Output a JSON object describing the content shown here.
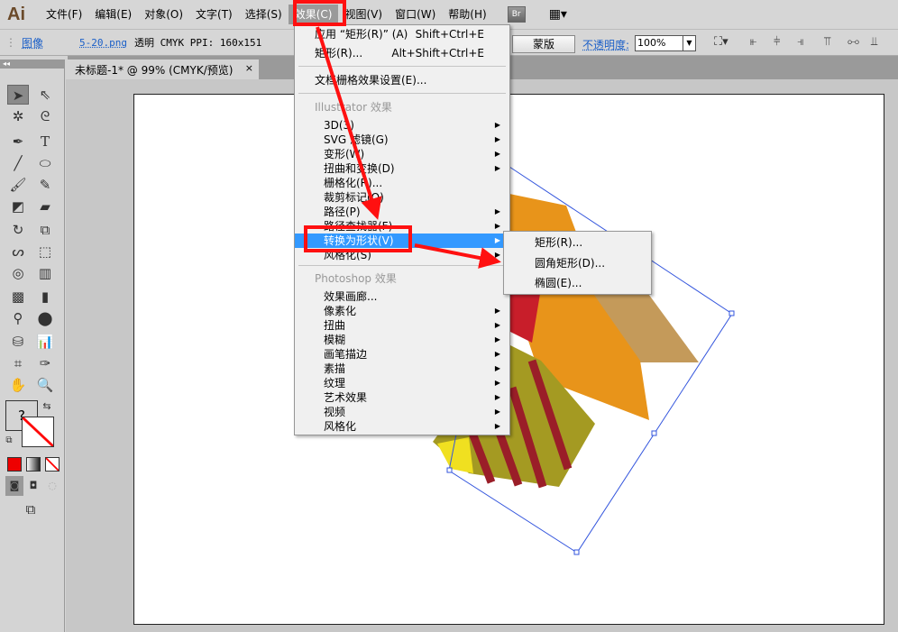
{
  "app": {
    "logo": "Ai"
  },
  "menubar": {
    "items": [
      "文件(F)",
      "编辑(E)",
      "对象(O)",
      "文字(T)",
      "选择(S)",
      "效果(C)",
      "视图(V)",
      "窗口(W)",
      "帮助(H)"
    ],
    "bridge": "Br"
  },
  "control": {
    "type": "图像",
    "file": "5-20.png",
    "info": "透明 CMYK  PPI: 160x151",
    "mask": "蒙版",
    "opacity_label": "不透明度:",
    "opacity": "100%"
  },
  "document": {
    "tab": "未标题-1* @ 99% (CMYK/预览)",
    "close": "×"
  },
  "tools": {
    "question": "?"
  },
  "effect_menu": {
    "apply": {
      "label": "应用 “矩形(R)” (A)",
      "shortcut": "Shift+Ctrl+E"
    },
    "rect": {
      "label": "矩形(R)...",
      "shortcut": "Alt+Shift+Ctrl+E"
    },
    "raster_settings": "文档栅格效果设置(E)...",
    "illustrator_header": "Illustrator 效果",
    "illustrator_items": [
      {
        "label": "3D(3)",
        "sub": true
      },
      {
        "label": "SVG 滤镜(G)",
        "sub": true
      },
      {
        "label": "变形(W)",
        "sub": true
      },
      {
        "label": "扭曲和变换(D)",
        "sub": true
      },
      {
        "label": "栅格化(R)...",
        "sub": false
      },
      {
        "label": "裁剪标记(O)",
        "sub": false
      },
      {
        "label": "路径(P)",
        "sub": true
      },
      {
        "label": "路径查找器(F)",
        "sub": true
      },
      {
        "label": "转换为形状(V)",
        "sub": true
      },
      {
        "label": "风格化(S)",
        "sub": true
      }
    ],
    "photoshop_header": "Photoshop 效果",
    "photoshop_items": [
      {
        "label": "效果画廊...",
        "sub": false
      },
      {
        "label": "像素化",
        "sub": true
      },
      {
        "label": "扭曲",
        "sub": true
      },
      {
        "label": "模糊",
        "sub": true
      },
      {
        "label": "画笔描边",
        "sub": true
      },
      {
        "label": "素描",
        "sub": true
      },
      {
        "label": "纹理",
        "sub": true
      },
      {
        "label": "艺术效果",
        "sub": true
      },
      {
        "label": "视频",
        "sub": true
      },
      {
        "label": "风格化",
        "sub": true
      }
    ]
  },
  "submenu": {
    "items": [
      "矩形(R)...",
      "圆角矩形(D)...",
      "椭圆(E)..."
    ]
  },
  "colors": {
    "highlight": "#3399ff",
    "annotation": "#ff1010",
    "selection": "#3355dd"
  }
}
